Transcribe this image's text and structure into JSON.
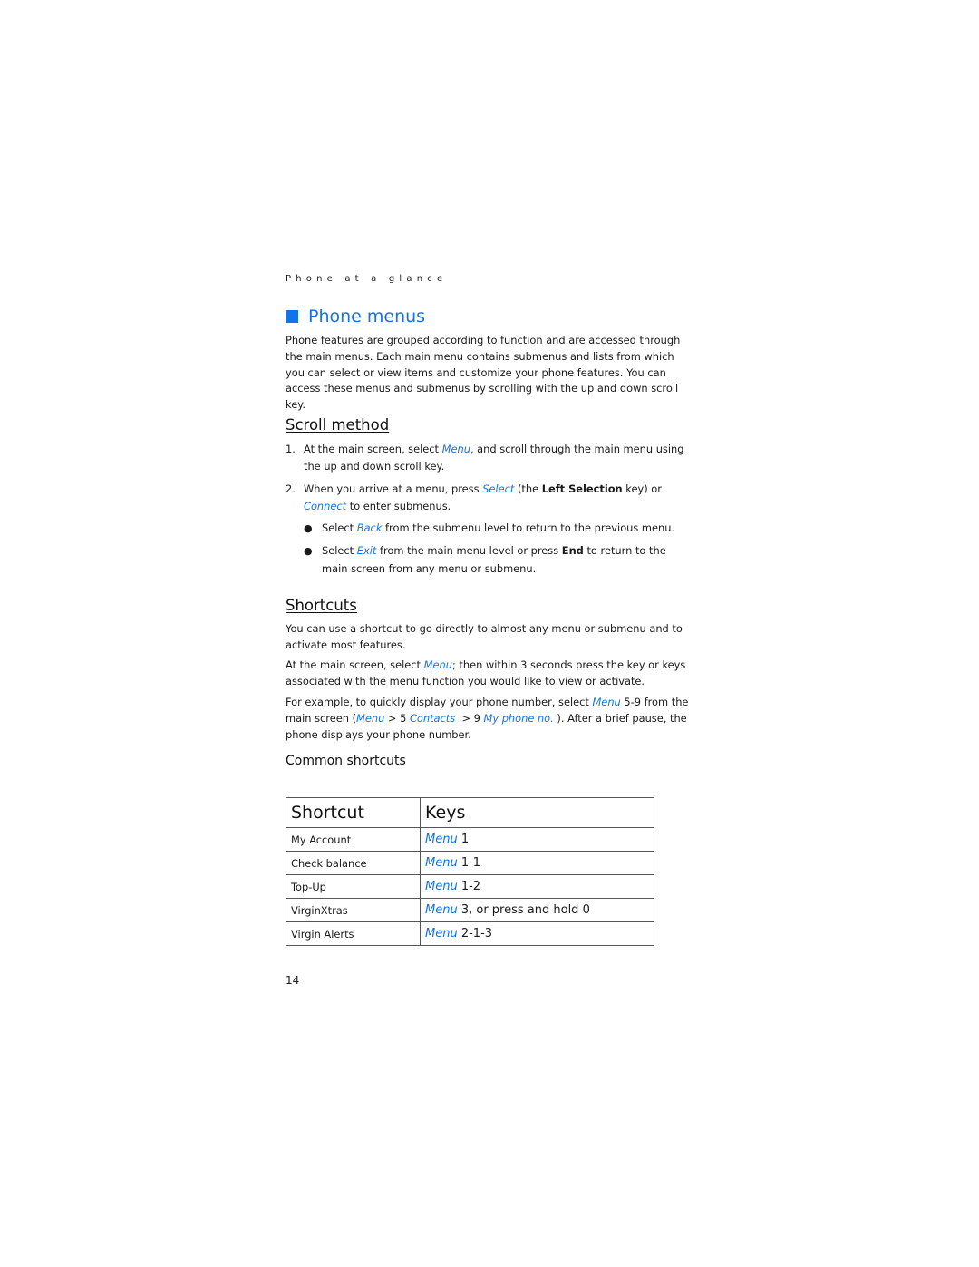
{
  "running_head": "Phone at a glance",
  "section": {
    "title": "Phone menus",
    "intro": "Phone features are grouped according to function and are accessed through the main menus. Each main menu contains submenus and lists from which you can select or view items and customize your phone features. You can access these menus and submenus by scrolling with the up and down scroll key."
  },
  "scroll_method": {
    "title": "Scroll method",
    "steps": [
      {
        "num": "1.",
        "pre": "At the main screen, select ",
        "link": "Menu",
        "post": ", and scroll through the main menu using the up and down scroll key."
      },
      {
        "num": "2.",
        "pre": "When you arrive at a menu, press ",
        "link": "Select",
        "mid1": " (the ",
        "bold": "Left Selection",
        "mid2": " key) or ",
        "link2": "Connect",
        "post": " to enter submenus."
      }
    ],
    "bullets": [
      {
        "pre": "Select ",
        "link": "Back",
        "post": " from the submenu level to return to the previous menu."
      },
      {
        "pre": "Select ",
        "link": "Exit",
        "mid": " from the main menu level or press ",
        "bold": "End",
        "post": " to return to the main screen from any menu or submenu."
      }
    ]
  },
  "shortcuts": {
    "title": "Shortcuts",
    "para1": "You can use a shortcut to go directly to almost any menu or submenu and to activate most features.",
    "para2": {
      "pre": "At the main screen, select ",
      "link": "Menu",
      "post": "; then within 3 seconds press the key or keys associated with the menu function you would like to view or activate."
    },
    "para3": {
      "pre": "For example, to quickly display your phone number, select ",
      "link1": "Menu",
      "mid1": " 5-9 from the main screen (",
      "link2": "Menu",
      "mid2": " > 5 ",
      "link3": "Contacts",
      "mid3": "  > 9 ",
      "link4": "My phone no.",
      "post": " ). After a brief pause, the phone displays your phone number."
    }
  },
  "common_shortcuts": {
    "title": "Common shortcuts",
    "table": {
      "headers": [
        "Shortcut",
        "Keys"
      ],
      "rows": [
        {
          "shortcut": "My Account",
          "keys_link": "Menu",
          "keys_rest": " 1"
        },
        {
          "shortcut": "Check balance",
          "keys_link": "Menu",
          "keys_rest": " 1-1"
        },
        {
          "shortcut": "Top-Up",
          "keys_link": "Menu",
          "keys_rest": " 1-2"
        },
        {
          "shortcut": "VirginXtras",
          "keys_link": "Menu",
          "keys_rest": " 3, or press and hold 0"
        },
        {
          "shortcut": "Virgin Alerts",
          "keys_link": "Menu",
          "keys_rest": " 2-1-3"
        }
      ]
    }
  },
  "page_number": "14",
  "colors": {
    "accent": "#1274e6",
    "text": "#1a1a1a"
  }
}
